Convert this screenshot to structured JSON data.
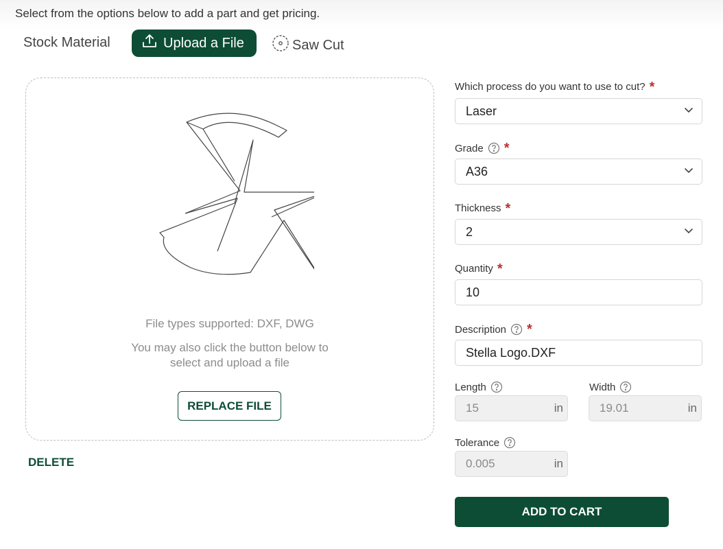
{
  "intro": "Select from the options below to add a part and get pricing.",
  "tabs": {
    "stock": "Stock Material",
    "upload": "Upload a File",
    "saw": "Saw Cut",
    "active": "upload"
  },
  "upload": {
    "file_types": "File types supported: DXF, DWG",
    "hint_line1": "You may also click the button below to",
    "hint_line2": "select and upload a file",
    "replace_button": "REPLACE FILE",
    "delete_link": "DELETE"
  },
  "form": {
    "process": {
      "label": "Which process do you want to use to cut?",
      "value": "Laser",
      "required": "*"
    },
    "grade": {
      "label": "Grade",
      "value": "A36",
      "required": "*"
    },
    "thickness": {
      "label": "Thickness",
      "value": "2",
      "required": "*"
    },
    "quantity": {
      "label": "Quantity",
      "value": "10",
      "required": "*"
    },
    "description": {
      "label": "Description",
      "value": "Stella Logo.DXF",
      "required": "*"
    },
    "length": {
      "label": "Length",
      "value": "15",
      "unit": "in"
    },
    "width": {
      "label": "Width",
      "value": "19.01",
      "unit": "in"
    },
    "tolerance": {
      "label": "Tolerance",
      "value": "0.005",
      "unit": "in"
    },
    "add_to_cart": "ADD TO CART"
  },
  "colors": {
    "brand_green": "#0d4d35",
    "required_red": "#b83232"
  },
  "icons": [
    "upload-icon",
    "saw-blade-icon",
    "chevron-down-icon",
    "help-circle-icon"
  ]
}
